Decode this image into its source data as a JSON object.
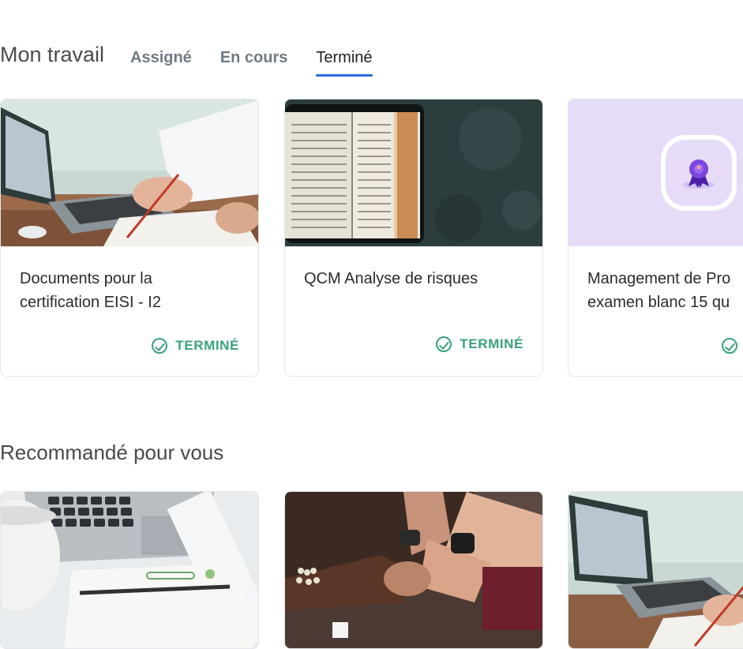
{
  "work": {
    "title": "Mon travail",
    "tabs": [
      {
        "label": "Assigné",
        "active": false
      },
      {
        "label": "En cours",
        "active": false
      },
      {
        "label": "Terminé",
        "active": true
      }
    ],
    "cards": [
      {
        "title_lines": [
          "Documents pour la",
          "certification EISI - I2"
        ],
        "status": "TERMINÉ",
        "thumbnail": "laptop-desk-photo"
      },
      {
        "title_lines": [
          "QCM Analyse de risques",
          ""
        ],
        "status": "TERMINÉ",
        "thumbnail": "open-book-photo"
      },
      {
        "title_lines": [
          "Management de Pro",
          "examen blanc 15 qu"
        ],
        "status": "TERMINÉ",
        "thumbnail": "award-badge-icon"
      }
    ]
  },
  "recommended": {
    "title": "Recommandé pour vous",
    "cards": [
      {
        "thumbnail": "keyboard-notebook-photo"
      },
      {
        "thumbnail": "fist-bump-photo"
      },
      {
        "thumbnail": "laptop-desk-photo"
      }
    ]
  },
  "colors": {
    "accent": "#2d6ae3",
    "success": "#3aa27a",
    "badge_bg": "#e6dcf8",
    "badge_icon": "#6a3fd0"
  }
}
